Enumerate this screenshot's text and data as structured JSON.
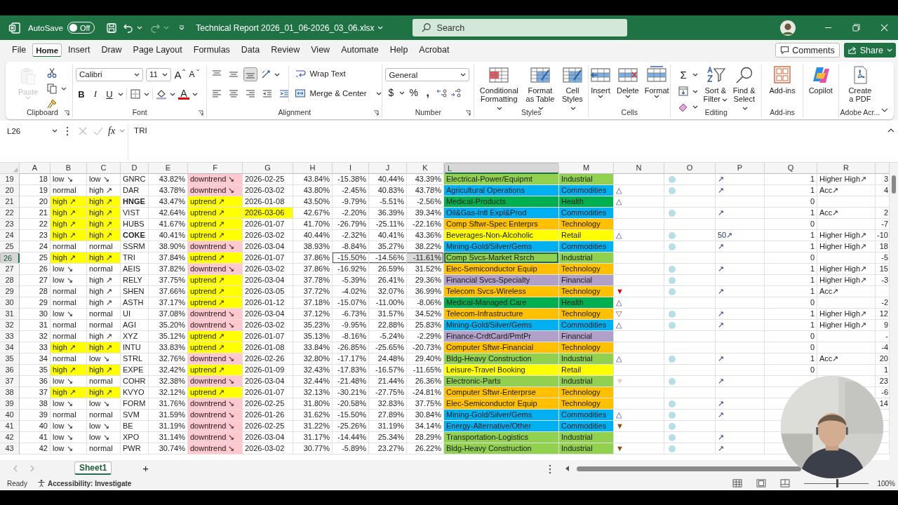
{
  "title_bar": {
    "autosave_label": "AutoSave",
    "autosave": {
      "label": "Off",
      "on": false
    },
    "redo": {
      "disabled": true
    },
    "file_name": "Technical Report 2026_01_06-2026_03_06.xlsx",
    "search": {
      "placeholder": "Search"
    }
  },
  "menu_tabs": [
    {
      "label": "File",
      "selected": false
    },
    {
      "label": "Home",
      "selected": true
    },
    {
      "label": "Insert",
      "selected": false
    },
    {
      "label": "Draw",
      "selected": false
    },
    {
      "label": "Page Layout",
      "selected": false
    },
    {
      "label": "Formulas",
      "selected": false
    },
    {
      "label": "Data",
      "selected": false
    },
    {
      "label": "Review",
      "selected": false
    },
    {
      "label": "View",
      "selected": false
    },
    {
      "label": "Automate",
      "selected": false
    },
    {
      "label": "Help",
      "selected": false
    },
    {
      "label": "Acrobat",
      "selected": false
    }
  ],
  "comments": "Comments",
  "share": "Share",
  "ribbon": {
    "clipboard": {
      "paste": {
        "label": "Paste",
        "disabled": true
      },
      "label": "Clipboard"
    },
    "font": {
      "family": "Calibri",
      "size": "11",
      "grow": "A",
      "shrink": "A",
      "bold": "B",
      "italic": "I",
      "underline": "U",
      "font_color_button": "A",
      "label": "Font"
    },
    "alignment": {
      "vertical": [
        {
          "selected": false
        },
        {
          "selected": false
        },
        {
          "selected": true
        }
      ],
      "wrap": "Wrap Text",
      "merge": "Merge & Center",
      "label": "Alignment"
    },
    "number": {
      "format": "General",
      "currency": "$",
      "percent": "%",
      "comma": ",",
      "label": "Number"
    },
    "styles": {
      "buttons": [
        "Conditional Formatting",
        "Format as Table",
        "Cell Styles"
      ],
      "label": "Styles"
    },
    "cells": {
      "buttons": [
        "Insert",
        "Delete",
        "Format"
      ],
      "label": "Cells"
    },
    "editing": {
      "sum": "Σ",
      "buttons": [
        "Sort & Filter",
        "Find & Select"
      ],
      "label": "Editing"
    },
    "addins": {
      "button": "Add-ins",
      "label": "Add-ins"
    },
    "copilot": "Copilot",
    "adobe": {
      "button": "Create a PDF",
      "label": "Adobe Acr..."
    }
  },
  "formula_bar": {
    "name_box": "L26",
    "fx": "fx",
    "value": "TRI"
  },
  "columns": [
    {
      "label": "A",
      "selected": false
    },
    {
      "label": "B",
      "selected": false
    },
    {
      "label": "C",
      "selected": false
    },
    {
      "label": "D",
      "selected": false
    },
    {
      "label": "E",
      "selected": false
    },
    {
      "label": "F",
      "selected": false
    },
    {
      "label": "G",
      "selected": false
    },
    {
      "label": "H",
      "selected": false
    },
    {
      "label": "I",
      "selected": false
    },
    {
      "label": "J",
      "selected": false
    },
    {
      "label": "K",
      "selected": false
    },
    {
      "label": "L",
      "selected": true
    },
    {
      "label": "M",
      "selected": false
    },
    {
      "label": "N",
      "selected": false
    },
    {
      "label": "O",
      "selected": false
    },
    {
      "label": "P",
      "selected": false
    },
    {
      "label": "Q",
      "selected": false
    },
    {
      "label": "R",
      "selected": false
    }
  ],
  "rows": [
    {
      "row": "19",
      "a": "18",
      "b": "low ↘",
      "c": "low ↘",
      "flag": false,
      "d": "GNRC",
      "bold": false,
      "e": "43.82%",
      "f": {
        "text": "downtrend ↘",
        "kind": "down"
      },
      "g": "2026-02-25",
      "g_flag": false,
      "h": "43.84%",
      "i": "-15.38%",
      "j": "40.44%",
      "k": "43.39%",
      "l": "Electrical-Power/Equipmt",
      "m": "Industrial",
      "color": "#92d050",
      "dot": true,
      "p": "↗",
      "q": "1",
      "r": "Higher High↗",
      "s": "3",
      "selected": false
    },
    {
      "row": "20",
      "a": "19",
      "b": "normal",
      "c": "high ↗",
      "flag": false,
      "d": "DAR",
      "bold": false,
      "e": "43.78%",
      "f": {
        "text": "downtrend ↘",
        "kind": "down"
      },
      "g": "2026-03-02",
      "g_flag": false,
      "h": "43.80%",
      "i": "-2.45%",
      "j": "40.83%",
      "k": "43.78%",
      "l": "Agricultural Operations",
      "m": "Commodities",
      "color": "#00b0f0",
      "n": {
        "glyph": "△",
        "kind": "outline"
      },
      "dot": true,
      "p": "↗",
      "q": "1",
      "r": "Acc↗",
      "s": "4",
      "selected": false
    },
    {
      "row": "21",
      "a": "20",
      "b": "high ↗",
      "c": "high ↗",
      "flag": true,
      "d": "HNGE",
      "bold": true,
      "e": "43.47%",
      "f": {
        "text": "uptrend ↗",
        "kind": "up"
      },
      "g": "2026-01-08",
      "g_flag": false,
      "h": "43.50%",
      "i": "-9.79%",
      "j": "-5.51%",
      "k": "-2.56%",
      "l": "Medical-Products",
      "m": "Health",
      "color": "#00b050",
      "n": {
        "glyph": "△",
        "kind": "outline"
      },
      "dot": false,
      "q": "0",
      "selected": false
    },
    {
      "row": "22",
      "a": "21",
      "b": "high ↗",
      "c": "high ↗",
      "flag": true,
      "d": "VIST",
      "bold": false,
      "e": "42.64%",
      "f": {
        "text": "uptrend ↗",
        "kind": "up"
      },
      "g": "2026-03-06",
      "g_flag": true,
      "h": "42.67%",
      "i": "-2.20%",
      "j": "36.39%",
      "k": "39.34%",
      "l": "Oil&Gas-Intl Expl&Prod",
      "m": "Commodities",
      "color": "#00b0f0",
      "dot": true,
      "p": "↗",
      "q": "1",
      "r": "Acc↗",
      "s": "2",
      "selected": false
    },
    {
      "row": "23",
      "a": "22",
      "b": "high ↗",
      "c": "high ↗",
      "flag": true,
      "d": "HUBS",
      "bold": false,
      "e": "41.67%",
      "f": {
        "text": "uptrend ↗",
        "kind": "up"
      },
      "g": "2026-01-07",
      "g_flag": false,
      "h": "41.70%",
      "i": "-26.79%",
      "j": "-25.11%",
      "k": "-22.16%",
      "l": "Comp Sftwr-Spec Enterprs",
      "m": "Technology",
      "color": "#ffc000",
      "dot": false,
      "q": "0",
      "s": "-7",
      "selected": false
    },
    {
      "row": "24",
      "a": "23",
      "b": "high ↗",
      "c": "high ↗",
      "flag": true,
      "d": "COKE",
      "bold": true,
      "e": "40.41%",
      "f": {
        "text": "uptrend ↗",
        "kind": "up"
      },
      "g": "2026-03-02",
      "g_flag": false,
      "h": "40.44%",
      "i": "-2.32%",
      "j": "40.41%",
      "k": "43.36%",
      "l": "Beverages-Non-Alcoholic",
      "m": "Retail",
      "color": "#ffff00",
      "n": {
        "glyph": "△",
        "kind": "outline"
      },
      "dot": true,
      "p": "50↗",
      "q": "1",
      "r": "Higher High↗",
      "s": "-10",
      "selected": false
    },
    {
      "row": "25",
      "a": "24",
      "b": "normal",
      "c": "normal",
      "flag": false,
      "d": "SSRM",
      "bold": false,
      "e": "38.90%",
      "f": {
        "text": "downtrend ↘",
        "kind": "down"
      },
      "g": "2026-03-04",
      "g_flag": false,
      "h": "38.93%",
      "i": "-8.84%",
      "j": "35.27%",
      "k": "38.22%",
      "l": "Mining-Gold/Silver/Gems",
      "m": "Commodities",
      "color": "#00b0f0",
      "dot": true,
      "p": "↗",
      "q": "1",
      "r": "Higher High↗",
      "s": "18",
      "selected": false
    },
    {
      "row": "26",
      "a": "25",
      "b": "high ↗",
      "c": "high ↗",
      "flag": true,
      "d": "TRI",
      "bold": false,
      "e": "37.84%",
      "f": {
        "text": "uptrend ↗",
        "kind": "up"
      },
      "g": "2026-01-07",
      "g_flag": false,
      "h": "37.86%",
      "i": "-15.50%",
      "j": "-14.56%",
      "k": "-11.61%",
      "l": "Comp Svcs-Market Rsrch",
      "m": "Industrial",
      "color": "#92d050",
      "dot": false,
      "q": "0",
      "s": "-5",
      "selected": true
    },
    {
      "row": "27",
      "a": "26",
      "b": "low ↘",
      "c": "normal",
      "flag": false,
      "d": "AEIS",
      "bold": false,
      "e": "37.82%",
      "f": {
        "text": "downtrend ↘",
        "kind": "down"
      },
      "g": "2026-03-02",
      "g_flag": false,
      "h": "37.86%",
      "i": "-16.92%",
      "j": "26.59%",
      "k": "31.52%",
      "l": "Elec-Semiconductor Equip",
      "m": "Technology",
      "color": "#ffc000",
      "dot": true,
      "p": "↗",
      "q": "1",
      "r": "Higher High↗",
      "s": "15",
      "selected": false
    },
    {
      "row": "28",
      "a": "27",
      "b": "low ↘",
      "c": "high ↗",
      "flag": false,
      "d": "RELY",
      "bold": false,
      "e": "37.75%",
      "f": {
        "text": "uptrend ↗",
        "kind": "up"
      },
      "g": "2026-03-04",
      "g_flag": false,
      "h": "37.78%",
      "i": "-5.39%",
      "j": "26.41%",
      "k": "29.36%",
      "l": "Financial Svcs-Specialty",
      "m": "Financial",
      "color": "#b1a0c7",
      "dot": true,
      "q": "1",
      "r": "Higher High↗",
      "s": "-3",
      "selected": false
    },
    {
      "row": "29",
      "a": "28",
      "b": "normal",
      "c": "high ↗",
      "flag": false,
      "d": "SHEN",
      "bold": false,
      "e": "37.66%",
      "f": {
        "text": "uptrend ↗",
        "kind": "up"
      },
      "g": "2026-03-05",
      "g_flag": false,
      "h": "37.72%",
      "i": "-4.02%",
      "j": "32.07%",
      "k": "36.99%",
      "l": "Telecom Svcs-Wireless",
      "m": "Technology",
      "color": "#ffc000",
      "n": {
        "glyph": "▼",
        "kind": "red"
      },
      "dot": true,
      "p": "↗",
      "q": "1",
      "r": "Acc↗",
      "selected": false
    },
    {
      "row": "30",
      "a": "29",
      "b": "normal",
      "c": "high ↗",
      "flag": false,
      "d": "ASTH",
      "bold": false,
      "e": "37.17%",
      "f": {
        "text": "uptrend ↗",
        "kind": "up"
      },
      "g": "2026-01-12",
      "g_flag": false,
      "h": "37.18%",
      "i": "-15.07%",
      "j": "-11.00%",
      "k": "-8.06%",
      "l": "Medical-Managed Care",
      "m": "Health",
      "color": "#00b050",
      "n": {
        "glyph": "△",
        "kind": "outline"
      },
      "dot": false,
      "q": "0",
      "s": "-2",
      "selected": false
    },
    {
      "row": "31",
      "a": "30",
      "b": "low ↘",
      "c": "normal",
      "flag": false,
      "d": "UI",
      "bold": false,
      "e": "37.08%",
      "f": {
        "text": "downtrend ↘",
        "kind": "down"
      },
      "g": "2026-03-04",
      "g_flag": false,
      "h": "37.12%",
      "i": "-6.73%",
      "j": "31.57%",
      "k": "34.52%",
      "l": "Telecom-Infrastructure",
      "m": "Technology",
      "color": "#ffc000",
      "n": {
        "glyph": "▽",
        "kind": "brown"
      },
      "dot": true,
      "p": "↗",
      "q": "1",
      "r": "Higher High↗",
      "s": "12",
      "selected": false
    },
    {
      "row": "32",
      "a": "31",
      "b": "normal",
      "c": "normal",
      "flag": false,
      "d": "AGI",
      "bold": false,
      "e": "35.20%",
      "f": {
        "text": "downtrend ↘",
        "kind": "down"
      },
      "g": "2026-03-02",
      "g_flag": false,
      "h": "35.23%",
      "i": "-9.95%",
      "j": "22.88%",
      "k": "25.83%",
      "l": "Mining-Gold/Silver/Gems",
      "m": "Commodities",
      "color": "#00b0f0",
      "n": {
        "glyph": "△",
        "kind": "outline"
      },
      "dot": true,
      "p": "↗",
      "q": "1",
      "r": "Higher High↗",
      "s": "9",
      "selected": false
    },
    {
      "row": "33",
      "a": "32",
      "b": "normal",
      "c": "high ↗",
      "flag": false,
      "d": "XYZ",
      "bold": false,
      "e": "35.12%",
      "f": {
        "text": "uptrend ↗",
        "kind": "up"
      },
      "g": "2026-01-07",
      "g_flag": false,
      "h": "35.13%",
      "i": "-8.16%",
      "j": "-5.24%",
      "k": "-2.29%",
      "l": "Finance-CrdtCard/PmtPr",
      "m": "Financial",
      "color": "#b1a0c7",
      "dot": false,
      "q": "0",
      "s": "-",
      "selected": false
    },
    {
      "row": "34",
      "a": "33",
      "b": "high ↗",
      "c": "high ↗",
      "flag": true,
      "d": "INTU",
      "bold": false,
      "e": "33.83%",
      "f": {
        "text": "uptrend ↗",
        "kind": "up"
      },
      "g": "2026-01-08",
      "g_flag": false,
      "h": "33.84%",
      "i": "-26.85%",
      "j": "-25.65%",
      "k": "-20.73%",
      "l": "Computer Sftwr-Financial",
      "m": "Technology",
      "color": "#ffc000",
      "dot": false,
      "q": "0",
      "s": "-4",
      "selected": false
    },
    {
      "row": "35",
      "a": "34",
      "b": "normal",
      "c": "low ↘",
      "flag": false,
      "d": "STRL",
      "bold": false,
      "e": "32.76%",
      "f": {
        "text": "downtrend ↘",
        "kind": "down"
      },
      "g": "2026-02-26",
      "g_flag": false,
      "h": "32.80%",
      "i": "-17.17%",
      "j": "24.48%",
      "k": "29.40%",
      "l": "Bldg-Heavy Construction",
      "m": "Industrial",
      "color": "#92d050",
      "n": {
        "glyph": "△",
        "kind": "outline"
      },
      "dot": true,
      "p": "↗",
      "q": "1",
      "r": "Acc↗",
      "s": "20",
      "selected": false
    },
    {
      "row": "36",
      "a": "35",
      "b": "high ↗",
      "c": "high ↗",
      "flag": true,
      "d": "EXPE",
      "bold": false,
      "e": "32.42%",
      "f": {
        "text": "uptrend ↗",
        "kind": "up"
      },
      "g": "2026-01-09",
      "g_flag": false,
      "h": "32.43%",
      "i": "-17.83%",
      "j": "-16.57%",
      "k": "-11.65%",
      "l": "Leisure-Travel Booking",
      "m": "Retail",
      "color": "#ffff00",
      "dot": false,
      "q": "0",
      "s": "1",
      "selected": false
    },
    {
      "row": "37",
      "a": "36",
      "b": "low ↘",
      "c": "normal",
      "flag": false,
      "d": "COHR",
      "bold": false,
      "e": "32.38%",
      "f": {
        "text": "downtrend ↘",
        "kind": "down"
      },
      "g": "2026-03-04",
      "g_flag": false,
      "h": "32.44%",
      "i": "-21.48%",
      "j": "21.44%",
      "k": "26.36%",
      "l": "Electronic-Parts",
      "m": "Industrial",
      "color": "#92d050",
      "n": {
        "glyph": "▼",
        "kind": "faint"
      },
      "dot": true,
      "p": "↗",
      "s": "23",
      "selected": false
    },
    {
      "row": "38",
      "a": "37",
      "b": "high ↗",
      "c": "high ↗",
      "flag": true,
      "d": "KVYO",
      "bold": false,
      "e": "32.12%",
      "f": {
        "text": "uptrend ↗",
        "kind": "up"
      },
      "g": "2026-01-07",
      "g_flag": false,
      "h": "32.13%",
      "i": "-30.21%",
      "j": "-27.75%",
      "k": "-24.81%",
      "l": "Computer Sftwr-Enterprse",
      "m": "Technology",
      "color": "#ffc000",
      "dot": false,
      "s": "-6",
      "selected": false
    },
    {
      "row": "39",
      "a": "38",
      "b": "low ↘",
      "c": "low ↘",
      "flag": false,
      "d": "FORM",
      "bold": false,
      "e": "31.76%",
      "f": {
        "text": "downtrend ↘",
        "kind": "down"
      },
      "g": "2026-02-25",
      "g_flag": false,
      "h": "31.80%",
      "i": "-20.58%",
      "j": "32.83%",
      "k": "37.75%",
      "l": "Elec-Semiconductor Equip",
      "m": "Technology",
      "color": "#ffc000",
      "dot": true,
      "p": "↗",
      "s": "14",
      "selected": false
    },
    {
      "row": "40",
      "a": "39",
      "b": "normal",
      "c": "normal",
      "flag": false,
      "d": "SVM",
      "bold": false,
      "e": "31.59%",
      "f": {
        "text": "downtrend ↘",
        "kind": "down"
      },
      "g": "2026-01-26",
      "g_flag": false,
      "h": "31.62%",
      "i": "-15.50%",
      "j": "27.89%",
      "k": "30.84%",
      "l": "Mining-Gold/Silver/Gems",
      "m": "Commodities",
      "color": "#00b0f0",
      "n": {
        "glyph": "△",
        "kind": "outline"
      },
      "dot": true,
      "p": "↗",
      "selected": false
    },
    {
      "row": "41",
      "a": "40",
      "b": "low ↘",
      "c": "low ↘",
      "flag": false,
      "d": "BE",
      "bold": false,
      "e": "31.19%",
      "f": {
        "text": "downtrend ↘",
        "kind": "down"
      },
      "g": "2026-02-25",
      "g_flag": false,
      "h": "31.22%",
      "i": "-25.26%",
      "j": "31.19%",
      "k": "34.14%",
      "l": "Energy-Alternative/Other",
      "m": "Commodities",
      "color": "#00b0f0",
      "n": {
        "glyph": "▼",
        "kind": "brown"
      },
      "dot": true,
      "selected": false
    },
    {
      "row": "42",
      "a": "41",
      "b": "low ↘",
      "c": "low ↘",
      "flag": false,
      "d": "XPO",
      "bold": false,
      "e": "31.14%",
      "f": {
        "text": "downtrend ↘",
        "kind": "down"
      },
      "g": "2026-03-04",
      "g_flag": false,
      "h": "31.17%",
      "i": "-14.44%",
      "j": "25.34%",
      "k": "28.29%",
      "l": "Transportation-Logistics",
      "m": "Industrial",
      "color": "#92d050",
      "dot": true,
      "p": "↗",
      "selected": false
    },
    {
      "row": "43",
      "a": "42",
      "b": "low ↘",
      "c": "normal",
      "flag": false,
      "d": "PWR",
      "bold": false,
      "e": "30.74%",
      "f": {
        "text": "downtrend ↘",
        "kind": "down"
      },
      "g": "2026-03-02",
      "g_flag": false,
      "h": "30.77%",
      "i": "-5.89%",
      "j": "23.27%",
      "k": "26.22%",
      "l": "Bldg-Heavy Construction",
      "m": "Industrial",
      "color": "#92d050",
      "n": {
        "glyph": "▼",
        "kind": "brown"
      },
      "dot": true,
      "p": "↗",
      "selected": false
    }
  ],
  "sheet_tabs": [
    {
      "label": "Sheet1",
      "selected": true
    }
  ],
  "add_sheet": "+",
  "status_bar": {
    "ready": "Ready",
    "accessibility": "Accessibility: Investigate",
    "zoom_slider": {
      "level": 0.5
    },
    "zoom": "100%"
  }
}
